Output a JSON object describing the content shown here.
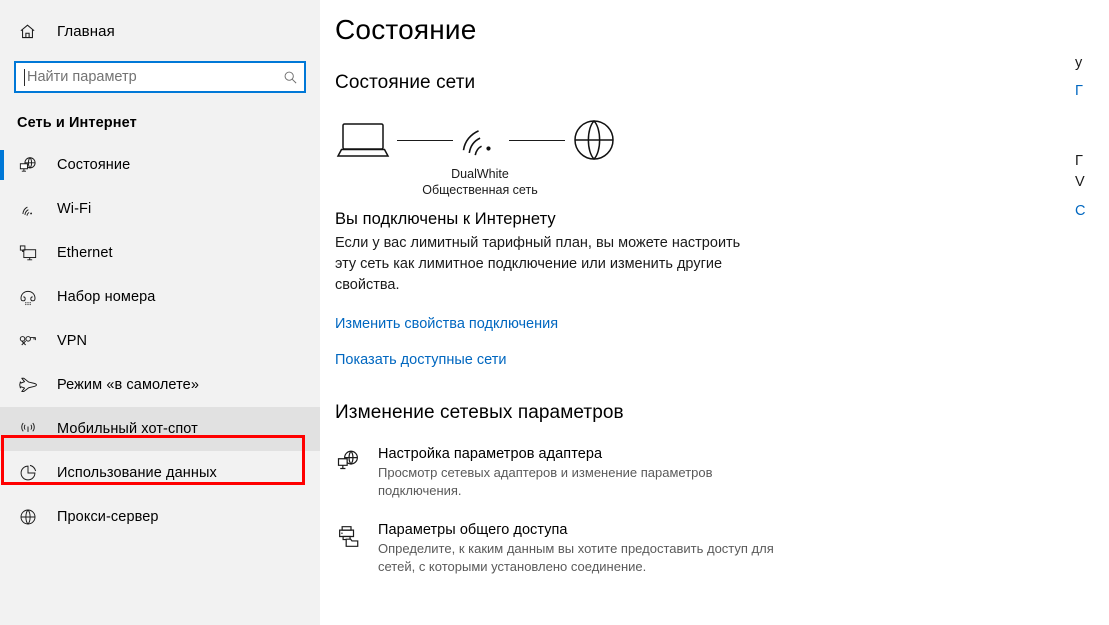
{
  "sidebar": {
    "home": {
      "label": "Главная",
      "icon": "home-icon"
    },
    "search": {
      "placeholder": "Найти параметр",
      "value": "",
      "icon": "search-icon"
    },
    "category": "Сеть и Интернет",
    "items": [
      {
        "label": "Состояние",
        "icon": "network-status-icon",
        "selected": true,
        "hover": false
      },
      {
        "label": "Wi-Fi",
        "icon": "wifi-icon",
        "selected": false,
        "hover": false
      },
      {
        "label": "Ethernet",
        "icon": "ethernet-icon",
        "selected": false,
        "hover": false
      },
      {
        "label": "Набор номера",
        "icon": "dialup-phone-icon",
        "selected": false,
        "hover": false
      },
      {
        "label": "VPN",
        "icon": "vpn-key-icon",
        "selected": false,
        "hover": false
      },
      {
        "label": "Режим «в самолете»",
        "icon": "airplane-icon",
        "selected": false,
        "hover": false
      },
      {
        "label": "Мобильный хот-спот",
        "icon": "hotspot-icon",
        "selected": false,
        "hover": true
      },
      {
        "label": "Использование данных",
        "icon": "data-usage-pie-icon",
        "selected": false,
        "hover": false
      },
      {
        "label": "Прокси-сервер",
        "icon": "globe-icon",
        "selected": false,
        "hover": false
      }
    ]
  },
  "annotation": {
    "target": "Мобильный хот-спот",
    "color": "#ff0000"
  },
  "main": {
    "page_title": "Состояние",
    "network_status_heading": "Состояние сети",
    "diagram": {
      "device_icon": "laptop-icon",
      "network_icon": "wifi-signal-icon",
      "internet_icon": "globe-icon",
      "ssid": "DualWhite",
      "network_type": "Общественная сеть"
    },
    "connection_title": "Вы подключены к Интернету",
    "connection_desc": "Если у вас лимитный тарифный план, вы можете настроить эту сеть как лимитное подключение или изменить другие свойства.",
    "link_change_properties": "Изменить свойства подключения",
    "link_show_networks": "Показать доступные сети",
    "settings_heading": "Изменение сетевых параметров",
    "options": [
      {
        "icon": "adapter-settings-icon",
        "title": "Настройка параметров адаптера",
        "desc": "Просмотр сетевых адаптеров и изменение параметров подключения."
      },
      {
        "icon": "sharing-options-icon",
        "title": "Параметры общего доступа",
        "desc": "Определите, к каким данным вы хотите предоставить доступ для сетей, с которыми установлено соединение."
      }
    ]
  },
  "right_rail": {
    "heading_1": "у",
    "link_1": "Г",
    "heading_2a": "Г",
    "heading_2b": "V",
    "link_2": "С"
  },
  "colors": {
    "accent": "#0078d7",
    "link": "#0067c0",
    "sidebar_bg": "#f2f2f2",
    "hover_bg": "#e1e1e1",
    "annotation": "#ff0000"
  }
}
